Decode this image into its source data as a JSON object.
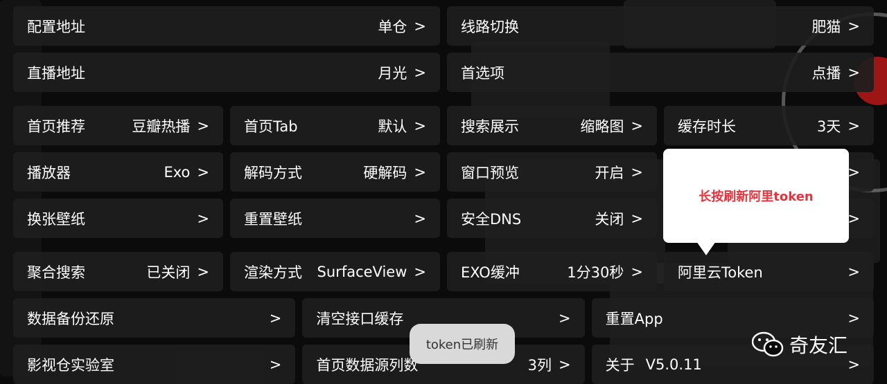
{
  "row1": [
    {
      "label": "配置地址",
      "value": "单仓"
    },
    {
      "label": "线路切换",
      "value": "肥猫"
    }
  ],
  "row2": [
    {
      "label": "直播地址",
      "value": "月光"
    },
    {
      "label": "首选项",
      "value": "点播"
    }
  ],
  "row3": [
    {
      "label": "首页推荐",
      "value": "豆瓣热播"
    },
    {
      "label": "首页Tab",
      "value": "默认"
    },
    {
      "label": "搜索展示",
      "value": "缩略图"
    },
    {
      "label": "缓存时长",
      "value": "3天"
    }
  ],
  "row4": [
    {
      "label": "播放器",
      "value": "Exo"
    },
    {
      "label": "解码方式",
      "value": "硬解码"
    },
    {
      "label": "窗口预览",
      "value": "开启"
    }
  ],
  "row5": [
    {
      "label": "换张壁纸",
      "value": ""
    },
    {
      "label": "重置壁纸",
      "value": ""
    },
    {
      "label": "安全DNS",
      "value": "关闭"
    }
  ],
  "row6": [
    {
      "label": "聚合搜索",
      "value": "已关闭"
    },
    {
      "label": "渲染方式",
      "value": "SurfaceView"
    },
    {
      "label": "EXO缓冲",
      "value": "1分30秒"
    },
    {
      "label": "阿里云Token",
      "value": ""
    }
  ],
  "row7": [
    {
      "label": "数据备份还原",
      "value": ""
    },
    {
      "label": "清空接口缓存",
      "value": ""
    },
    {
      "label": "重置App",
      "value": ""
    }
  ],
  "row8": [
    {
      "label": "影视仓实验室",
      "value": ""
    },
    {
      "label": "首页数据源列数",
      "value": "3列"
    },
    {
      "label": "关于",
      "value": "V5.0.11"
    }
  ],
  "chevron": ">",
  "tooltip": {
    "text": "长按刷新阿里token"
  },
  "toast": {
    "text": "token已刷新"
  },
  "watermark": {
    "text": "奇友汇"
  }
}
